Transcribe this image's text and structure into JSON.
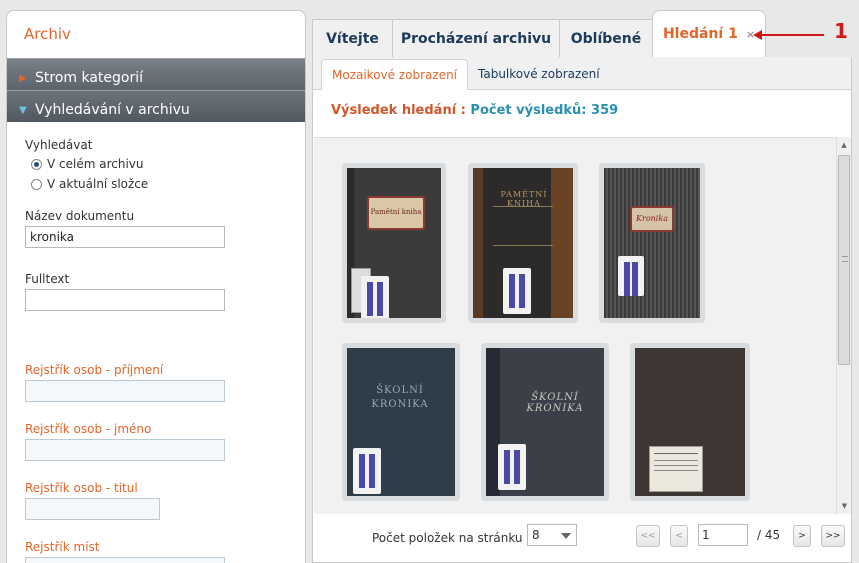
{
  "left": {
    "title": "Archiv",
    "accordion": [
      {
        "label": "Strom kategorií"
      },
      {
        "label": "Vyhledávání v archivu"
      }
    ],
    "search_scope_label": "Vyhledávat",
    "scope_options": [
      "V celém archivu",
      "V aktuální složce"
    ],
    "fields": {
      "doc_name": {
        "label": "Název dokumentu",
        "value": "kronika"
      },
      "fulltext": {
        "label": "Fulltext",
        "value": ""
      },
      "surname": {
        "label": "Rejstřík osob - příjmení",
        "value": ""
      },
      "firstname": {
        "label": "Rejstřík osob - jméno",
        "value": ""
      },
      "title": {
        "label": "Rejstřík osob - titul",
        "value": ""
      },
      "places": {
        "label": "Rejstřík míst",
        "value": ""
      }
    }
  },
  "tabs": [
    {
      "label": "Vítejte"
    },
    {
      "label": "Procházení archivu"
    },
    {
      "label": "Oblíbené"
    },
    {
      "label": "Hledání 1",
      "close": "×"
    }
  ],
  "subtabs": [
    "Mozaikové zobrazení",
    "Tabulkové zobrazení"
  ],
  "result": {
    "prefix": "Výsledek hledání :",
    "count_text": "Počet výsledků: 359"
  },
  "thumb_texts": {
    "t1_label": "Pamětní kniha",
    "t2_text": "PAMĚTNÍ KNIHA",
    "t3_label": "Kronika",
    "t4_text": "ŠKOLNÍ KRONIKA",
    "t5_text": "ŠKOLNÍ KRONIKA"
  },
  "pager": {
    "per_page_label": "Počet položek na stránku",
    "per_page_value": "8",
    "first": "<<",
    "prev": "<",
    "page": "1",
    "of": "/  45",
    "next": ">",
    "last": ">>"
  },
  "annotation": {
    "number": "1"
  },
  "colors": {
    "accent": "#e0672b",
    "header_dark": "#5d636a",
    "link_blue": "#1c3a5a",
    "result_blue": "#2a8fb0",
    "annotation_red": "#d01818"
  }
}
